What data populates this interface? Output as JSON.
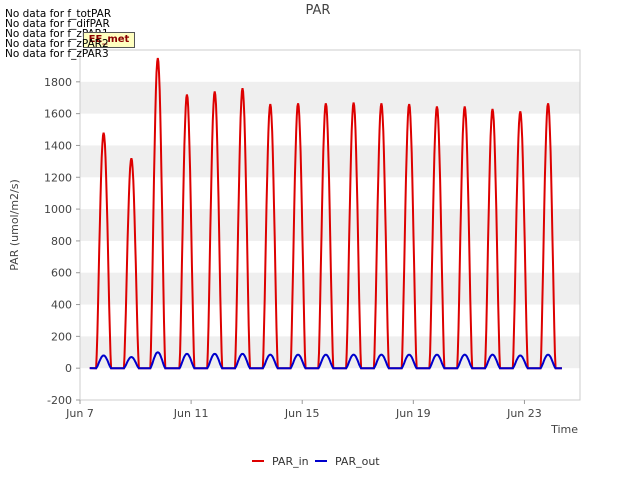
{
  "no_data_messages": [
    "No data for f_totPAR",
    "No data for f_difPAR",
    "No data for f_zPAR1",
    "No data for f_zPAR2",
    "No data for f_zPAR3"
  ],
  "badge_label": "EE_met",
  "chart_data": {
    "type": "line",
    "title": "PAR",
    "xlabel": "Time",
    "ylabel": "PAR (umol/m2/s)",
    "ylim": [
      -200,
      2000
    ],
    "yticks": [
      -200,
      0,
      200,
      400,
      600,
      800,
      1000,
      1200,
      1400,
      1600,
      1800
    ],
    "xlim_days": [
      7,
      25
    ],
    "xticks": [
      {
        "day": 7,
        "label": "Jun 7"
      },
      {
        "day": 11,
        "label": "Jun 11"
      },
      {
        "day": 15,
        "label": "Jun 15"
      },
      {
        "day": 19,
        "label": "Jun 19"
      },
      {
        "day": 23,
        "label": "Jun 23"
      }
    ],
    "grid": "horizontal alternating bands",
    "legend_position": "bottom-center",
    "series": [
      {
        "name": "PAR_in",
        "color": "#dd0000",
        "daily_peaks": [
          {
            "day": 7.85,
            "peak": 1480
          },
          {
            "day": 8.85,
            "peak": 1320
          },
          {
            "day": 9.8,
            "peak": 1950
          },
          {
            "day": 10.85,
            "peak": 1720
          },
          {
            "day": 11.85,
            "peak": 1740
          },
          {
            "day": 12.85,
            "peak": 1760
          },
          {
            "day": 13.85,
            "peak": 1660
          },
          {
            "day": 14.85,
            "peak": 1665
          },
          {
            "day": 15.85,
            "peak": 1665
          },
          {
            "day": 16.85,
            "peak": 1670
          },
          {
            "day": 17.85,
            "peak": 1665
          },
          {
            "day": 18.85,
            "peak": 1660
          },
          {
            "day": 19.85,
            "peak": 1645
          },
          {
            "day": 20.85,
            "peak": 1645
          },
          {
            "day": 21.85,
            "peak": 1630
          },
          {
            "day": 22.85,
            "peak": 1615
          },
          {
            "day": 23.85,
            "peak": 1665
          }
        ]
      },
      {
        "name": "PAR_out",
        "color": "#0000cc",
        "daily_peaks": [
          {
            "day": 7.85,
            "peak": 80
          },
          {
            "day": 8.85,
            "peak": 70
          },
          {
            "day": 9.8,
            "peak": 100
          },
          {
            "day": 10.85,
            "peak": 90
          },
          {
            "day": 11.85,
            "peak": 90
          },
          {
            "day": 12.85,
            "peak": 90
          },
          {
            "day": 13.85,
            "peak": 85
          },
          {
            "day": 14.85,
            "peak": 85
          },
          {
            "day": 15.85,
            "peak": 85
          },
          {
            "day": 16.85,
            "peak": 85
          },
          {
            "day": 17.85,
            "peak": 85
          },
          {
            "day": 18.85,
            "peak": 85
          },
          {
            "day": 19.85,
            "peak": 85
          },
          {
            "day": 20.85,
            "peak": 85
          },
          {
            "day": 21.85,
            "peak": 85
          },
          {
            "day": 22.85,
            "peak": 80
          },
          {
            "day": 23.85,
            "peak": 85
          }
        ]
      }
    ]
  }
}
